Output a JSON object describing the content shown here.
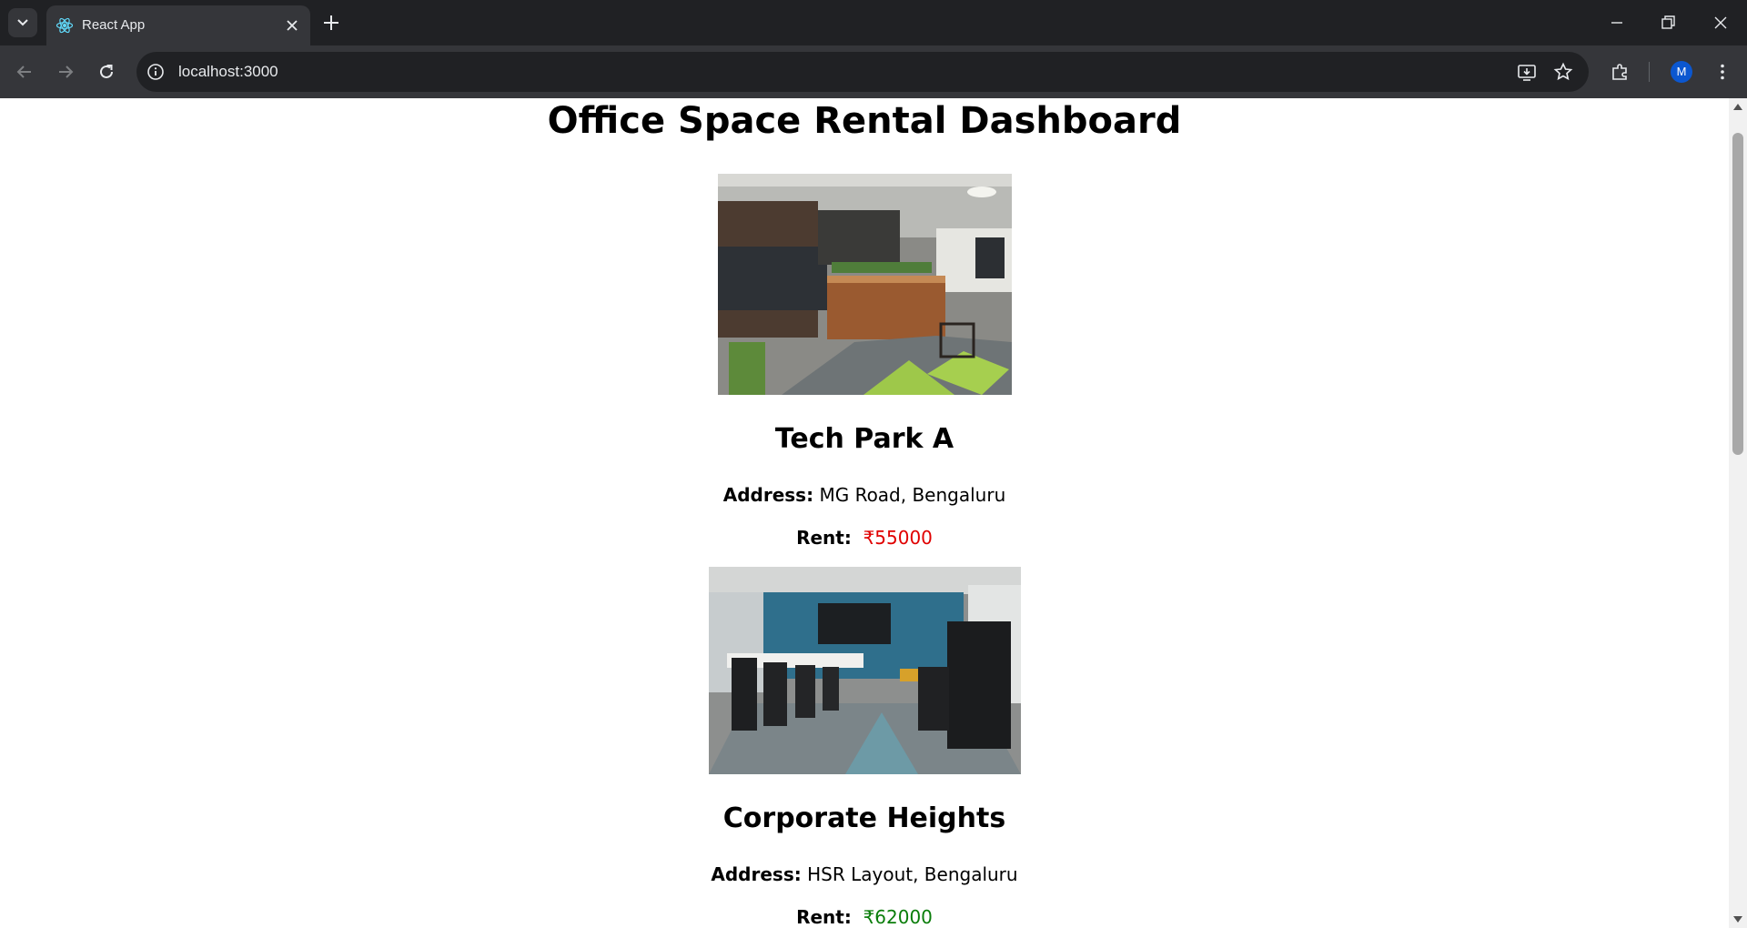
{
  "browser": {
    "tab_title": "React App",
    "url": "localhost:3000",
    "profile_initial": "M"
  },
  "page": {
    "heading": "Office Space Rental Dashboard",
    "address_label": "Address:",
    "rent_label": "Rent:",
    "offices": [
      {
        "name": "Tech Park A",
        "address": "MG Road, Bengaluru",
        "rent": "₹55000",
        "rent_color": "#e00000"
      },
      {
        "name": "Corporate Heights",
        "address": "HSR Layout, Bengaluru",
        "rent": "₹62000",
        "rent_color": "#0a7d0a"
      }
    ]
  }
}
